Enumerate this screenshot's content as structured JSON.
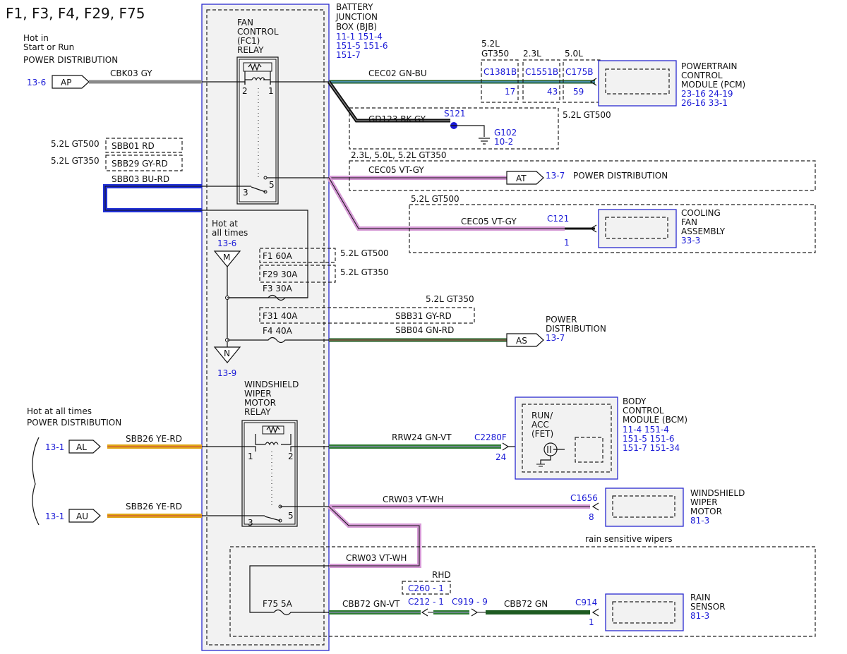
{
  "title": "F1, F3, F4, F29, F75",
  "bjb": {
    "name_lines": [
      "BATTERY",
      "JUNCTION",
      "BOX (BJB)"
    ],
    "refs": [
      "11-1  151-4",
      "151-5 151-6",
      "151-7"
    ]
  },
  "fan_relay": {
    "label_lines": [
      "FAN",
      "CONTROL",
      "(FC1)",
      "RELAY"
    ],
    "pins": [
      "2",
      "1",
      "3",
      "5"
    ]
  },
  "wiper_relay": {
    "label_lines": [
      "WINDSHIELD",
      "WIPER",
      "MOTOR",
      "RELAY"
    ],
    "pins": [
      "1",
      "2",
      "3",
      "5"
    ]
  },
  "sources": {
    "ap": {
      "label": "AP",
      "ref": "13-6",
      "desc": [
        "Hot in",
        "Start or Run",
        "POWER DISTRIBUTION"
      ],
      "wire": "CBK03  GY"
    },
    "al": {
      "label": "AL",
      "ref": "13-1",
      "wire": "SBB26  YE-RD"
    },
    "au": {
      "label": "AU",
      "ref": "13-1",
      "wire": "SBB26  YE-RD"
    },
    "hot_all_times": [
      "Hot at all times",
      "POWER DISTRIBUTION"
    ],
    "m": {
      "label": "M",
      "desc": [
        "Hot at",
        "all times"
      ],
      "ref": "13-6"
    },
    "n": {
      "label": "N",
      "ref": "13-9"
    }
  },
  "sbb_labels": [
    {
      "variant": "5.2L GT500",
      "wire": "SBB01  RD"
    },
    {
      "variant": "5.2L GT350",
      "wire": "SBB29  GY-RD"
    },
    {
      "variant": "",
      "wire": "SBB03  BU-RD"
    }
  ],
  "fuses": {
    "f1": "F1   60A",
    "f1_variant": "5.2L GT500",
    "f29": "F29  30A",
    "f29_variant": "5.2L GT350",
    "f3": "F3   30A",
    "f31": "F31  40A",
    "f31_variant": "5.2L GT350",
    "f4": "F4   40A",
    "f75": "F75  5A"
  },
  "wires": {
    "cec02": "CEC02  GN-BU",
    "gd123": "GD123  BK-GY",
    "s121": "S121",
    "g102": [
      "G102",
      "10-2"
    ],
    "gd_variant": "5.2L GT500",
    "cec05_top_variant": "2.3L, 5.0L, 5.2L GT350",
    "cec05_top": "CEC05  VT-GY",
    "cec05_bot_variant": "5.2L GT500",
    "cec05_bot": "CEC05  VT-GY",
    "sbb31": "SBB31  GY-RD",
    "sbb04": "SBB04  GN-RD",
    "rrw24": "RRW24  GN-VT",
    "crw03_a": "CRW03  VT-WH",
    "crw03_b": "CRW03  VT-WH",
    "cbb72_a": "CBB72  GN-VT",
    "cbb72_b": "CBB72  GN"
  },
  "connectors": {
    "c1381b": {
      "variant": [
        "5.2L",
        "GT350"
      ],
      "name": "C1381B",
      "pin": "17"
    },
    "c1551b": {
      "variant": [
        "2.3L"
      ],
      "name": "C1551B",
      "pin": "43"
    },
    "c175b": {
      "variant": [
        "5.0L"
      ],
      "name": "C175B",
      "pin": "59"
    },
    "c121": {
      "name": "C121",
      "pin": "1"
    },
    "c2280f": {
      "name": "C2280F",
      "pin": "24"
    },
    "c1656": {
      "name": "C1656",
      "pin": "8"
    },
    "c260": "C260 - 1",
    "c212": "C212 - 1",
    "c919": "C919 - 9",
    "rhd": "RHD",
    "c914": {
      "name": "C914",
      "pin": "1"
    }
  },
  "targets": {
    "at": {
      "label": "AT",
      "ref": "13-7",
      "desc": "POWER DISTRIBUTION"
    },
    "as": {
      "label": "AS",
      "ref": "13-7",
      "desc": [
        "POWER",
        "DISTRIBUTION"
      ]
    }
  },
  "modules": {
    "pcm": {
      "name": [
        "POWERTRAIN",
        "CONTROL",
        "MODULE (PCM)"
      ],
      "refs": [
        "23-16 24-19",
        "26-16 33-1"
      ]
    },
    "fan": {
      "name": [
        "COOLING",
        "FAN",
        "ASSEMBLY"
      ],
      "refs": [
        "33-3"
      ]
    },
    "bcm": {
      "name": [
        "BODY",
        "CONTROL",
        "MODULE (BCM)"
      ],
      "refs": [
        "11-4  151-4",
        "151-5  151-6",
        "151-7  151-34"
      ],
      "inner": [
        "RUN/",
        "ACC",
        "(FET)"
      ]
    },
    "wiper_motor": {
      "name": [
        "WINDSHIELD",
        "WIPER",
        "MOTOR"
      ],
      "refs": [
        "81-3"
      ]
    },
    "rain": {
      "name": [
        "RAIN",
        "SENSOR"
      ],
      "refs": [
        "81-3"
      ]
    }
  },
  "rain_label": "rain sensitive wipers",
  "colors": {
    "gray": "#8a8a8a",
    "green": "#1e5b22",
    "green_light": "#2e7d32",
    "violet": "#d69ad6",
    "blue": "#1f2fd6",
    "yellow": "#e0a615",
    "black": "#111111",
    "ref_blue": "#1a1ad6"
  }
}
